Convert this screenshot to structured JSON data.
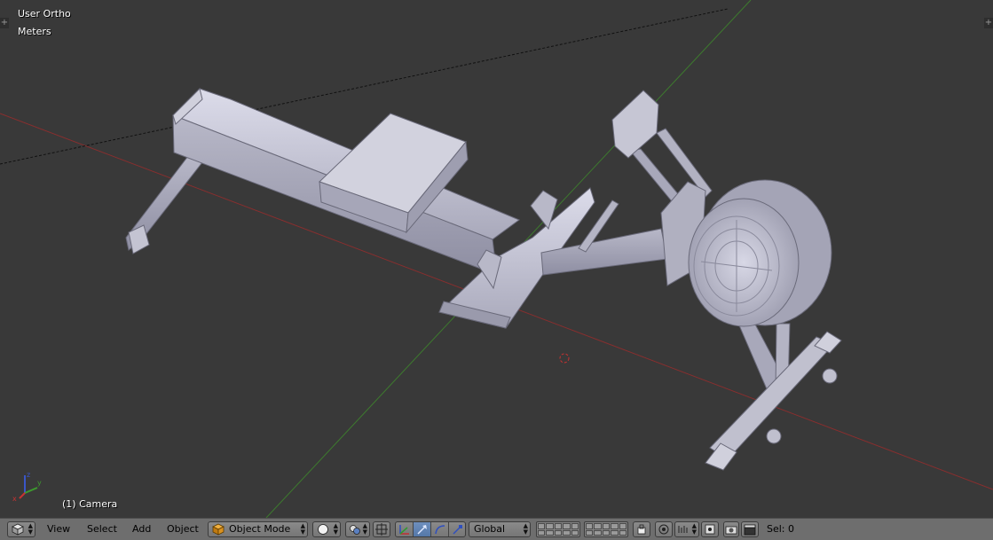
{
  "app": "Blender 3D Viewport",
  "viewport": {
    "view_name": "User Ortho",
    "units": "Meters",
    "object_info": "(1) Camera"
  },
  "header": {
    "editor_type_icon": "cube-icon",
    "menus": [
      "View",
      "Select",
      "Add",
      "Object"
    ],
    "mode": "Object Mode",
    "viewport_shading_icon": "solid-sphere-icon",
    "pivot_icon": "pivot-point-icon",
    "manipulator_icon": "manipulator-icon",
    "transform_space": "Global",
    "status": "Sel: 0"
  },
  "colors": {
    "background": "#393939",
    "x_axis": "#8a2e2e",
    "y_axis": "#3d7a2e",
    "model": "#c9c9d6",
    "header": "#6e6e6e"
  }
}
